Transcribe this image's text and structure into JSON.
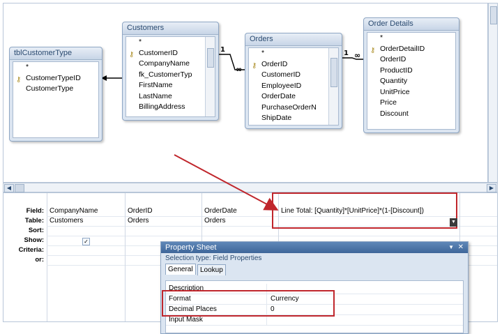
{
  "tables": {
    "customer_type": {
      "title": "tblCustomerType",
      "fields": [
        "*",
        "CustomerTypeID",
        "CustomerType"
      ]
    },
    "customers": {
      "title": "Customers",
      "fields": [
        "*",
        "CustomerID",
        "CompanyName",
        "fk_CustomerTyp",
        "FirstName",
        "LastName",
        "BillingAddress"
      ]
    },
    "orders": {
      "title": "Orders",
      "fields": [
        "*",
        "OrderID",
        "CustomerID",
        "EmployeeID",
        "OrderDate",
        "PurchaseOrderN",
        "ShipDate"
      ]
    },
    "order_details": {
      "title": "Order Details",
      "fields": [
        "*",
        "OrderDetailID",
        "OrderID",
        "ProductID",
        "Quantity",
        "UnitPrice",
        "Price",
        "Discount"
      ]
    }
  },
  "relationships": {
    "one_symbol": "1",
    "many_symbol": "∞"
  },
  "grid": {
    "row_labels": {
      "field": "Field:",
      "table": "Table:",
      "sort": "Sort:",
      "show": "Show:",
      "criteria": "Criteria:",
      "or": "or:"
    },
    "columns": [
      {
        "field": "CompanyName",
        "table": "Customers",
        "show": "✓"
      },
      {
        "field": "OrderID",
        "table": "Orders"
      },
      {
        "field": "OrderDate",
        "table": "Orders"
      },
      {
        "field": "Line Total: [Quantity]*[UnitPrice]*(1-[Discount])",
        "table": ""
      }
    ]
  },
  "property_sheet": {
    "title": "Property Sheet",
    "pin_glyph": "▼",
    "close_glyph": "✕",
    "selection_type_label": "Selection type:",
    "selection_type_value": "Field Properties",
    "tabs": [
      "General",
      "Lookup"
    ],
    "properties": [
      {
        "name": "Description",
        "value": ""
      },
      {
        "name": "Format",
        "value": "Currency"
      },
      {
        "name": "Decimal Places",
        "value": "0"
      },
      {
        "name": "Input Mask",
        "value": ""
      }
    ]
  },
  "colors": {
    "annotation": "#c0262c",
    "title_bar": "#3e6699",
    "panel": "#dbe5f1"
  }
}
